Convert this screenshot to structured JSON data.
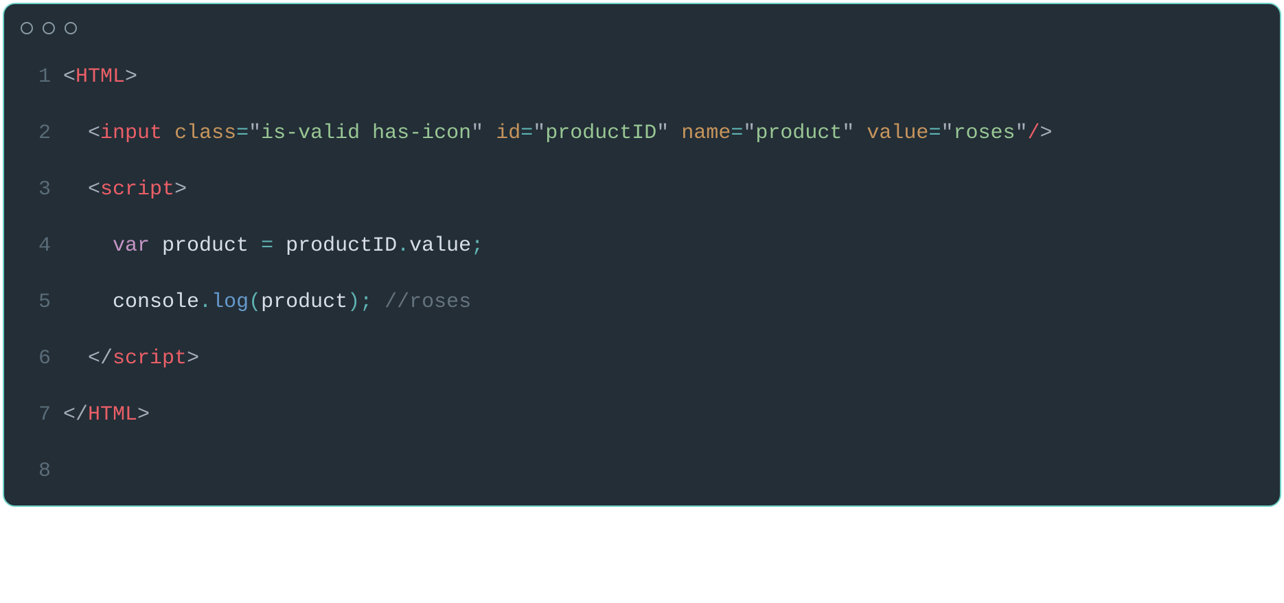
{
  "editor": {
    "lines": [
      {
        "num": "1",
        "indent": "",
        "tokens": [
          {
            "cls": "tok-punct",
            "t": "<"
          },
          {
            "cls": "tok-tag",
            "t": "HTML"
          },
          {
            "cls": "tok-punct",
            "t": ">"
          }
        ]
      },
      {
        "num": "2",
        "indent": "  ",
        "tokens": [
          {
            "cls": "tok-punct",
            "t": "<"
          },
          {
            "cls": "tok-tag",
            "t": "input"
          },
          {
            "cls": "tok-default",
            "t": " "
          },
          {
            "cls": "tok-attr",
            "t": "class"
          },
          {
            "cls": "tok-op",
            "t": "="
          },
          {
            "cls": "tok-punct",
            "t": "\""
          },
          {
            "cls": "tok-string",
            "t": "is-valid has-icon"
          },
          {
            "cls": "tok-punct",
            "t": "\""
          },
          {
            "cls": "tok-default",
            "t": " "
          },
          {
            "cls": "tok-attr",
            "t": "id"
          },
          {
            "cls": "tok-op",
            "t": "="
          },
          {
            "cls": "tok-punct",
            "t": "\""
          },
          {
            "cls": "tok-string",
            "t": "productID"
          },
          {
            "cls": "tok-punct",
            "t": "\""
          },
          {
            "cls": "tok-default",
            "t": " "
          },
          {
            "cls": "tok-attr",
            "t": "name"
          },
          {
            "cls": "tok-op",
            "t": "="
          },
          {
            "cls": "tok-punct",
            "t": "\""
          },
          {
            "cls": "tok-string",
            "t": "product"
          },
          {
            "cls": "tok-punct",
            "t": "\""
          },
          {
            "cls": "tok-default",
            "t": " "
          },
          {
            "cls": "tok-attr",
            "t": "value"
          },
          {
            "cls": "tok-op",
            "t": "="
          },
          {
            "cls": "tok-punct",
            "t": "\""
          },
          {
            "cls": "tok-string",
            "t": "roses"
          },
          {
            "cls": "tok-punct",
            "t": "\""
          },
          {
            "cls": "tok-tag",
            "t": "/"
          },
          {
            "cls": "tok-punct",
            "t": ">"
          }
        ]
      },
      {
        "num": "3",
        "indent": "  ",
        "tokens": [
          {
            "cls": "tok-punct",
            "t": "<"
          },
          {
            "cls": "tok-tag",
            "t": "script"
          },
          {
            "cls": "tok-punct",
            "t": ">"
          }
        ]
      },
      {
        "num": "4",
        "indent": "    ",
        "tokens": [
          {
            "cls": "tok-keyword",
            "t": "var"
          },
          {
            "cls": "tok-default",
            "t": " product "
          },
          {
            "cls": "tok-op",
            "t": "="
          },
          {
            "cls": "tok-default",
            "t": " productID"
          },
          {
            "cls": "tok-op",
            "t": "."
          },
          {
            "cls": "tok-default",
            "t": "value"
          },
          {
            "cls": "tok-op",
            "t": ";"
          }
        ]
      },
      {
        "num": "5",
        "indent": "    ",
        "tokens": [
          {
            "cls": "tok-default",
            "t": "console"
          },
          {
            "cls": "tok-op",
            "t": "."
          },
          {
            "cls": "tok-fn",
            "t": "log"
          },
          {
            "cls": "tok-op",
            "t": "("
          },
          {
            "cls": "tok-default",
            "t": "product"
          },
          {
            "cls": "tok-op",
            "t": ")"
          },
          {
            "cls": "tok-op",
            "t": ";"
          },
          {
            "cls": "tok-default",
            "t": " "
          },
          {
            "cls": "tok-comment",
            "t": "//roses"
          }
        ]
      },
      {
        "num": "6",
        "indent": "  ",
        "tokens": [
          {
            "cls": "tok-punct",
            "t": "</"
          },
          {
            "cls": "tok-tag",
            "t": "script"
          },
          {
            "cls": "tok-punct",
            "t": ">"
          }
        ]
      },
      {
        "num": "7",
        "indent": "",
        "tokens": [
          {
            "cls": "tok-punct",
            "t": "</"
          },
          {
            "cls": "tok-tag",
            "t": "HTML"
          },
          {
            "cls": "tok-punct",
            "t": ">"
          }
        ]
      },
      {
        "num": "8",
        "indent": "",
        "tokens": []
      }
    ]
  }
}
